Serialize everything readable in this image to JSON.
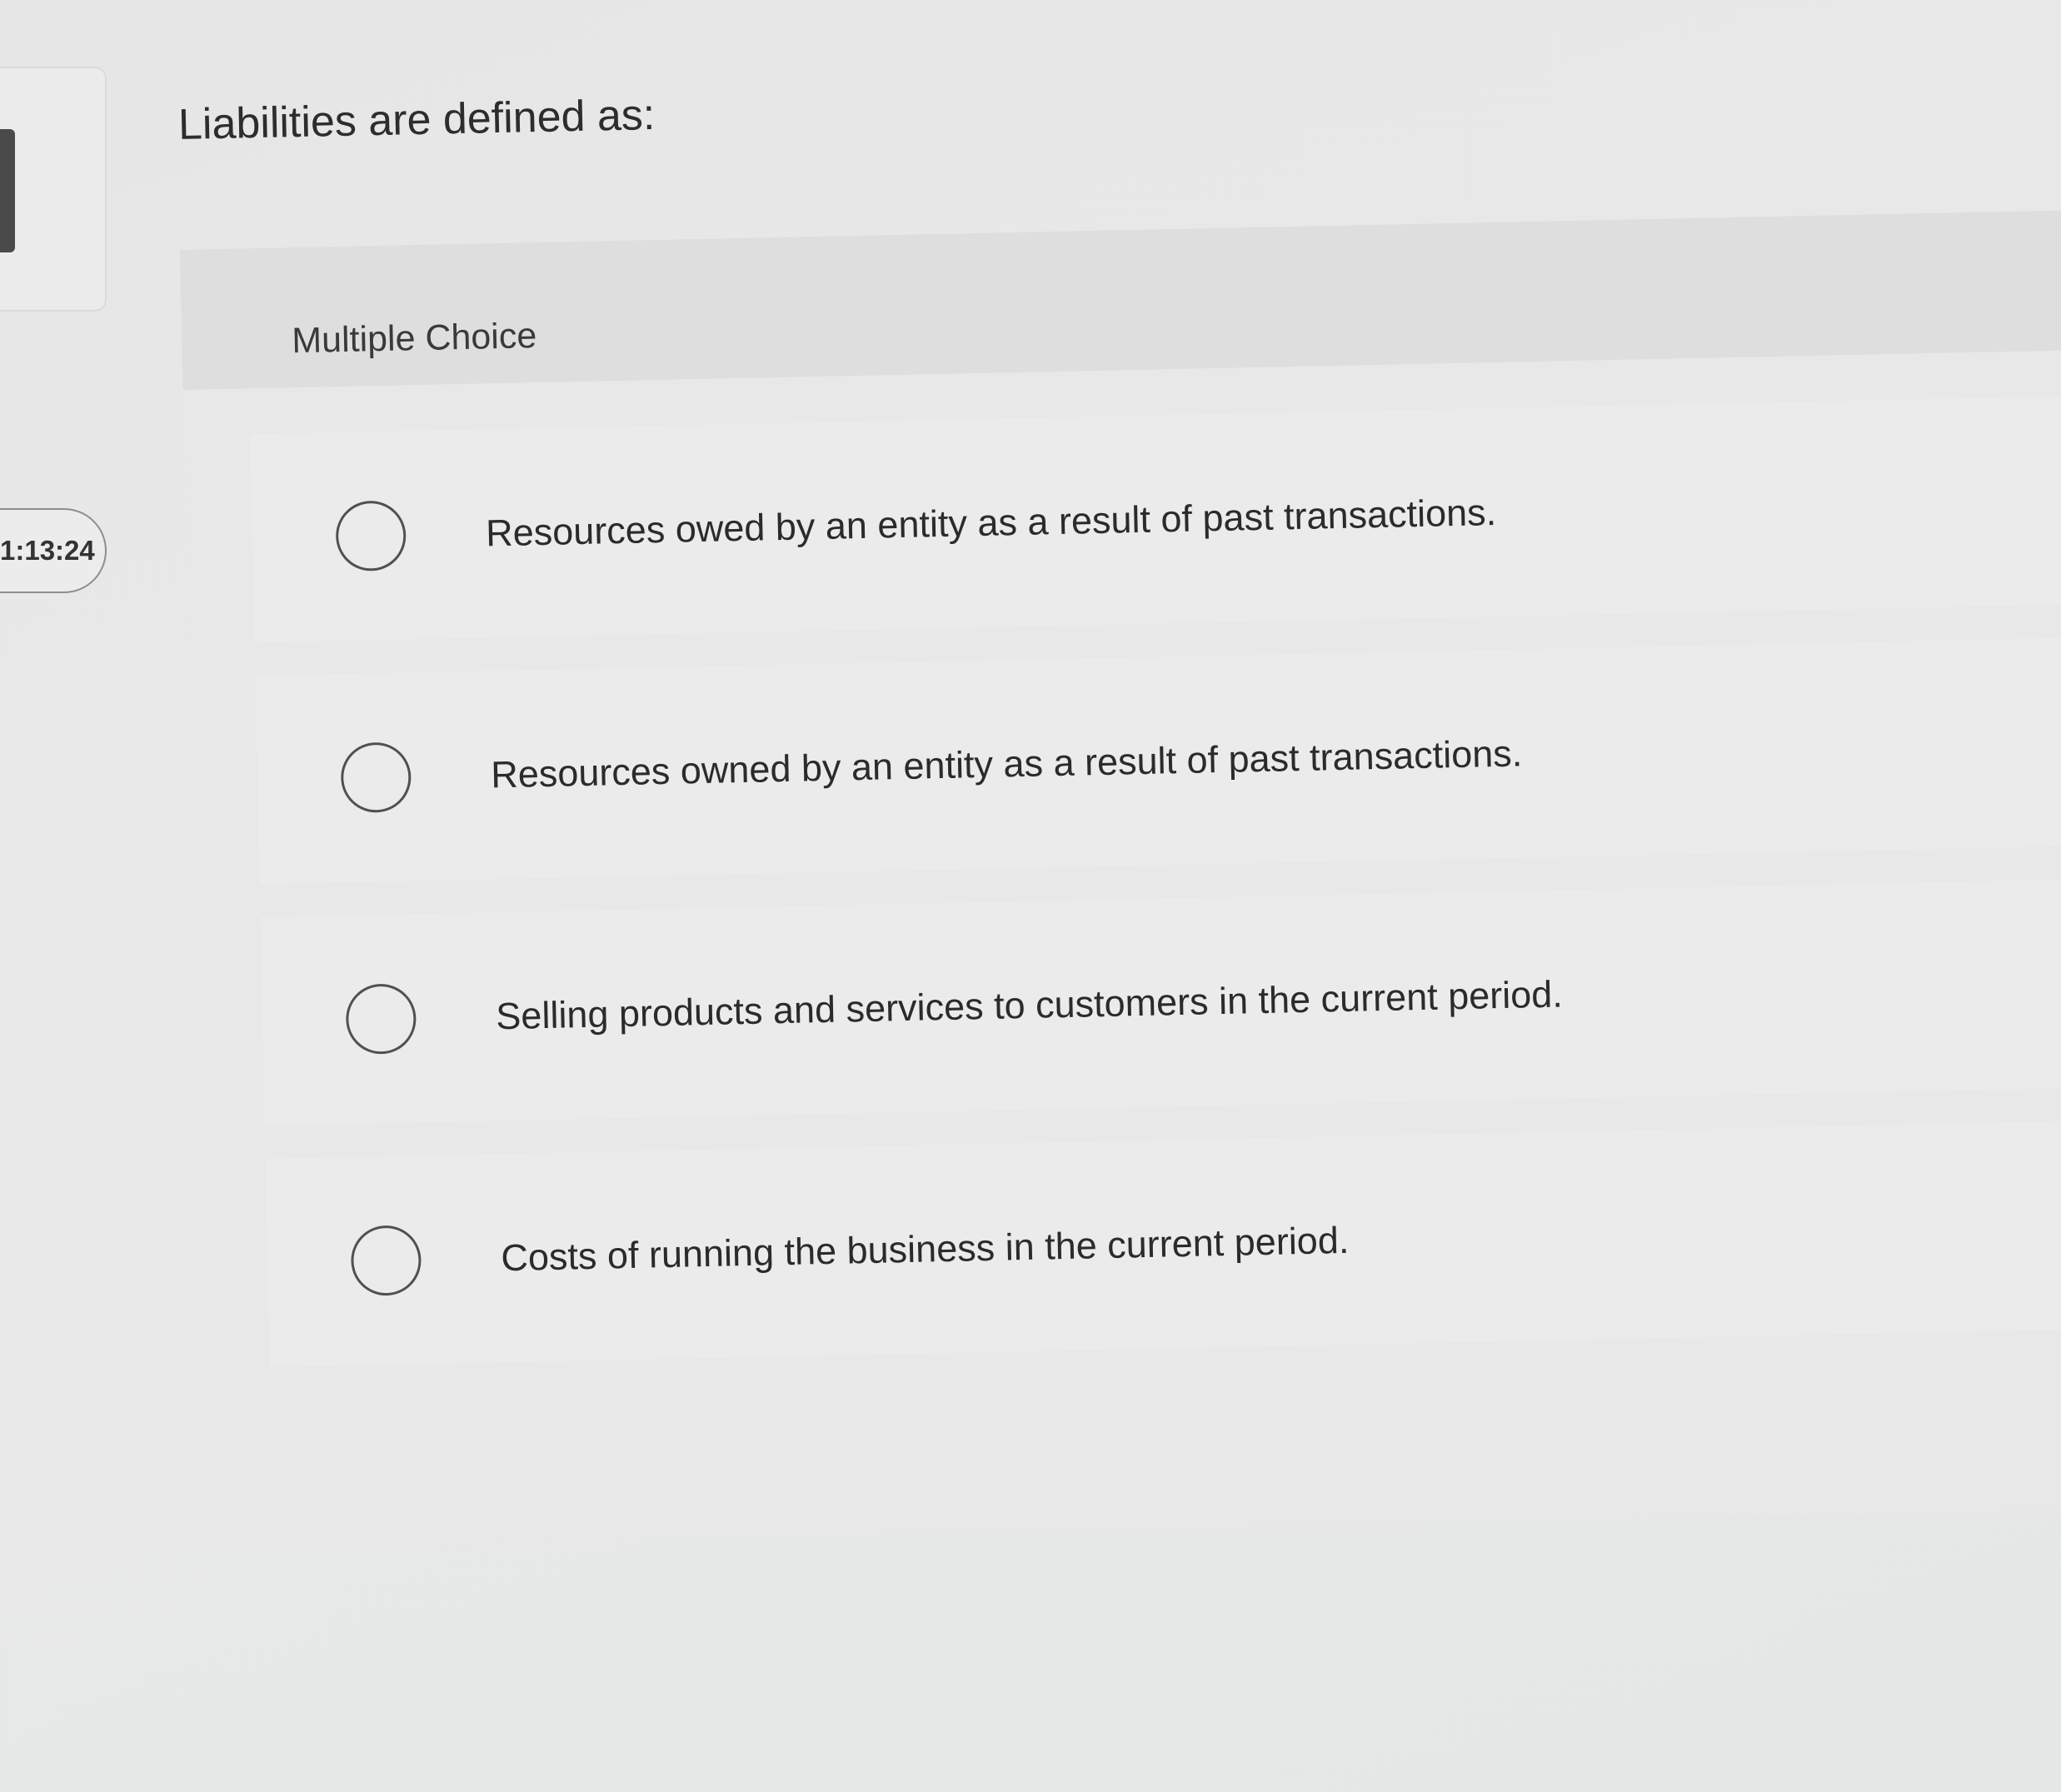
{
  "timer": {
    "label": "1:13:24"
  },
  "question": {
    "text": "Liabilities are defined as:"
  },
  "card": {
    "type_label": "Multiple Choice"
  },
  "options": [
    {
      "text": "Resources owed by an entity as a result of past transactions."
    },
    {
      "text": "Resources owned by an entity as a result of past transactions."
    },
    {
      "text": "Selling products and services to customers in the current period."
    },
    {
      "text": "Costs of running the business in the current period."
    }
  ]
}
